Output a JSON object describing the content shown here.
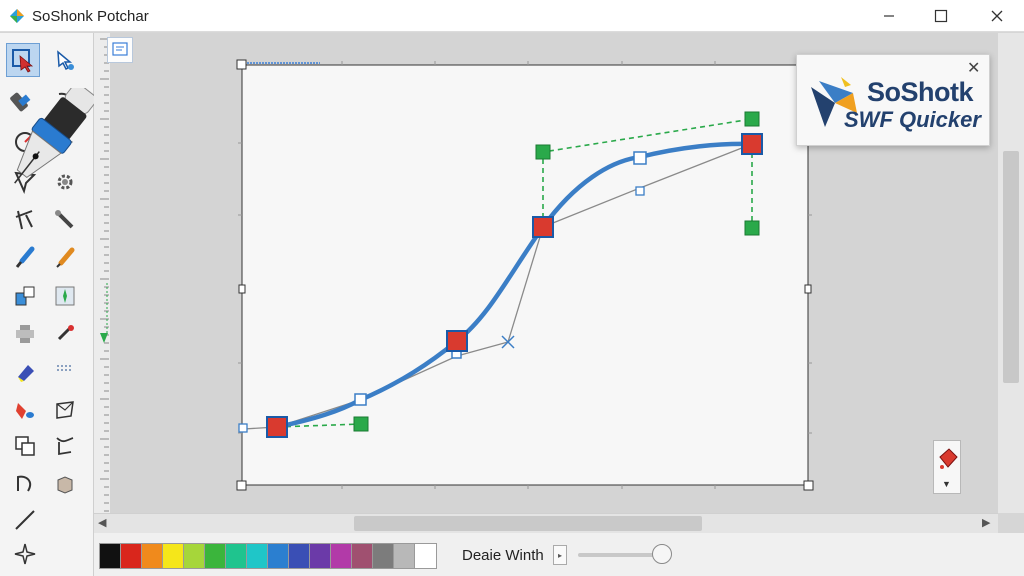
{
  "window": {
    "title": "SoShonk Potchar",
    "controls": {
      "minimize": "minimize",
      "maximize": "maximize",
      "close": "close"
    }
  },
  "toolbar": {
    "tools": [
      {
        "name": "selection-tool",
        "icon": "arrow-select-icon",
        "selected": true
      },
      {
        "name": "subselect-tool",
        "icon": "subselect-icon"
      },
      {
        "name": "pen-tool",
        "icon": "pen-nib-icon"
      },
      {
        "name": "lasso-tool",
        "icon": "lasso-icon"
      },
      {
        "name": "rotate-tool",
        "icon": "rotate-icon"
      },
      {
        "name": "free-transform-tool",
        "icon": "transform-icon"
      },
      {
        "name": "gradient-tool",
        "icon": "gradient-icon"
      },
      {
        "name": "gear-tool",
        "icon": "gear-icon"
      },
      {
        "name": "line-tool",
        "icon": "line-icon"
      },
      {
        "name": "bone-tool",
        "icon": "bone-icon"
      },
      {
        "name": "brush-tool",
        "icon": "brush-icon"
      },
      {
        "name": "pencil-tool",
        "icon": "pencil-icon"
      },
      {
        "name": "ink-bottle-tool",
        "icon": "ink-bottle-icon"
      },
      {
        "name": "deco-tool",
        "icon": "deco-icon"
      },
      {
        "name": "shape-tool",
        "icon": "shape-icon"
      },
      {
        "name": "eyedropper-tool",
        "icon": "eyedropper-icon"
      },
      {
        "name": "eraser-tool",
        "icon": "eraser-icon"
      },
      {
        "name": "hand-tool",
        "icon": "hand-icon"
      },
      {
        "name": "paint-bucket-tool",
        "icon": "paint-bucket-icon"
      },
      {
        "name": "envelope-tool",
        "icon": "envelope-icon"
      },
      {
        "name": "copy-tool",
        "icon": "copy-icon"
      },
      {
        "name": "ribbon-tool",
        "icon": "ribbon-icon"
      },
      {
        "name": "undo-tool",
        "icon": "undo-icon"
      },
      {
        "name": "cube-tool",
        "icon": "cube-icon"
      },
      {
        "name": "straight-line-tool",
        "icon": "straight-line-icon"
      },
      {
        "name": "sparkle-tool",
        "icon": "sparkle-icon"
      }
    ]
  },
  "palette": {
    "colors": [
      "#111111",
      "#d9261c",
      "#f08a1c",
      "#f5e61a",
      "#a6d63a",
      "#3bb53c",
      "#1fc48e",
      "#1fc6c8",
      "#2b7fd0",
      "#3a4fb5",
      "#6b3aa8",
      "#b23aa8",
      "#a05070",
      "#7c7c7c",
      "#b8b8b8",
      "#ffffff"
    ]
  },
  "stroke": {
    "width_label": "Deaie Winth"
  },
  "branding": {
    "name": "SoShotk",
    "subtitle": "SWF Quicker"
  },
  "colors": {
    "curve": "#3b7ec6",
    "anchor": "#d93a2f",
    "handle": "#2aa94a",
    "guide": "#1f9a3a",
    "selection": "#6d9fd4"
  }
}
